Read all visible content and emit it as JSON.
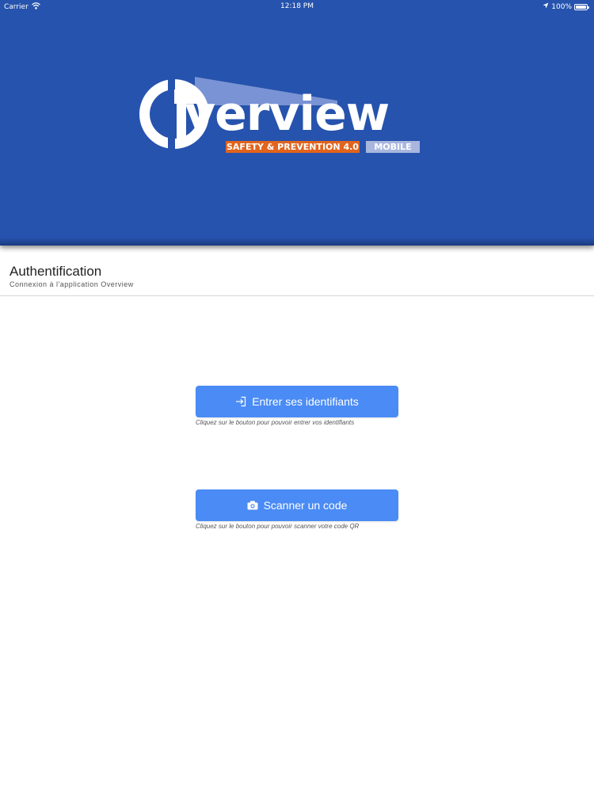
{
  "status_bar": {
    "carrier": "Carrier",
    "time": "12:18 PM",
    "battery": "100%",
    "icons": [
      "wifi-icon",
      "location-icon",
      "battery-icon"
    ]
  },
  "logo": {
    "word": "verview",
    "tagline": "SAFETY & PREVENTION 4.0",
    "badge": "MOBILE"
  },
  "auth": {
    "title": "Authentification",
    "subtitle": "Connexion à l'application Overview"
  },
  "actions": {
    "login": {
      "label": "Entrer ses identifiants",
      "help": "Cliquez sur le bouton pour pouvoir entrer vos identifiants",
      "icon": "sign-in-icon"
    },
    "scan": {
      "label": "Scanner un code",
      "help": "Cliquez sur le bouton pour pouvoir scanner votre code QR",
      "icon": "camera-icon"
    }
  },
  "colors": {
    "hero_background": "#2653ad",
    "button": "#4a8bf5",
    "tagline_background": "#e2641d",
    "badge_background": "#a9b7df"
  }
}
